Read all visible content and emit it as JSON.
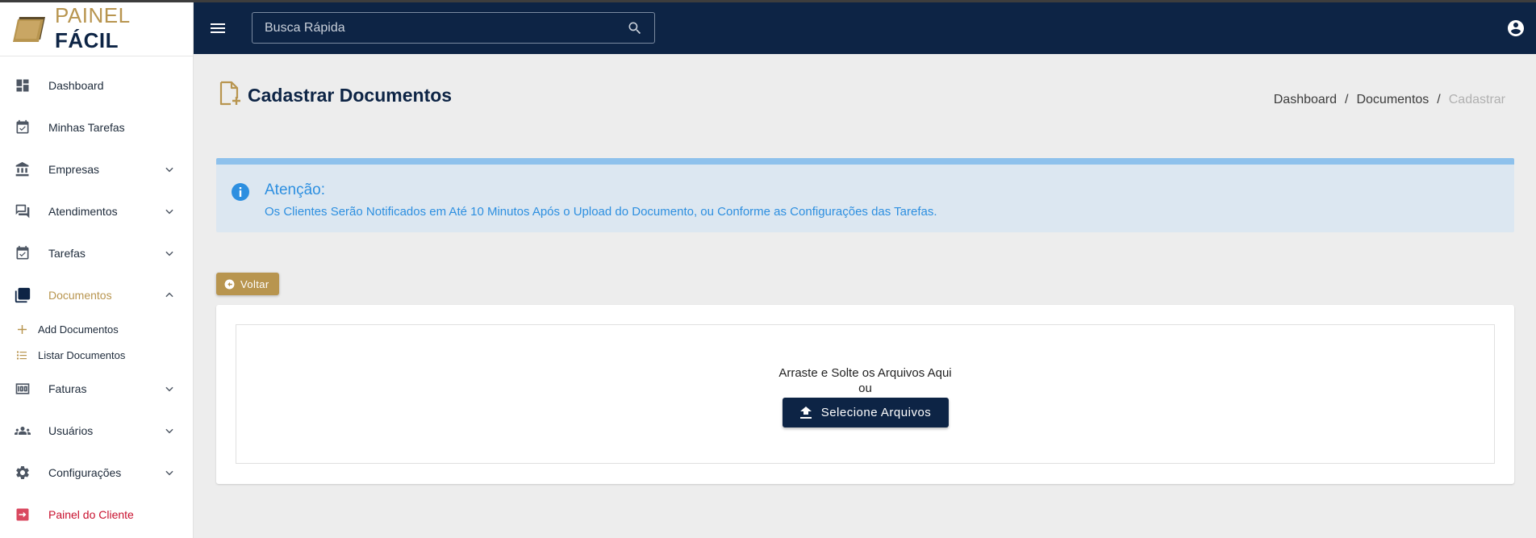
{
  "brand": {
    "part1": "PAINEL",
    "part2": "FÁCIL",
    "gold": "#b8954f",
    "navy": "#0d2445"
  },
  "header": {
    "search_placeholder": "Busca Rápida"
  },
  "sidebar": {
    "items": [
      {
        "label": "Dashboard",
        "icon": "dashboard-icon"
      },
      {
        "label": "Minhas Tarefas",
        "icon": "calendar-check-icon"
      },
      {
        "label": "Empresas",
        "icon": "bank-icon"
      },
      {
        "label": "Atendimentos",
        "icon": "forum-icon"
      },
      {
        "label": "Tarefas",
        "icon": "calendar-check-icon"
      },
      {
        "label": "Documentos",
        "icon": "documents-icon"
      },
      {
        "label": "Faturas",
        "icon": "money-icon"
      },
      {
        "label": "Usuários",
        "icon": "users-icon"
      },
      {
        "label": "Configurações",
        "icon": "gear-icon"
      },
      {
        "label": "Painel do Cliente",
        "icon": "exit-icon"
      }
    ],
    "documents_sub": [
      {
        "label": "Add Documentos",
        "icon": "plus-icon"
      },
      {
        "label": "Listar Documentos",
        "icon": "list-icon"
      }
    ]
  },
  "page": {
    "title": "Cadastrar Documentos",
    "breadcrumb": [
      "Dashboard",
      "Documentos",
      "Cadastrar"
    ],
    "breadcrumb_sep": "/"
  },
  "alert": {
    "title": "Atenção:",
    "text": "Os Clientes Serão Notificados em Até 10 Minutos Após o Upload do Documento, ou Conforme as Configurações das Tarefas."
  },
  "back_button": "Voltar",
  "upload": {
    "drag_text": "Arraste e Solte os Arquivos Aqui",
    "or_text": "ou",
    "select_label": "Selecione Arquivos"
  }
}
